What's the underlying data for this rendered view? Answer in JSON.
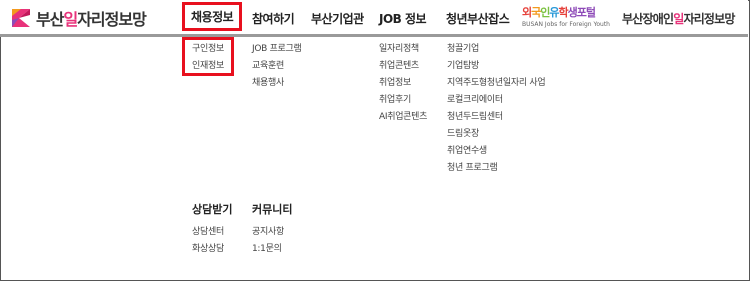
{
  "logo": {
    "prefix": "부산",
    "highlight": "일",
    "suffix": "자리정보망",
    "brand_colors": [
      "#e8327a",
      "#8e4bb8",
      "#f39a1e"
    ]
  },
  "nav": {
    "items": [
      "채용정보",
      "참여하기",
      "부산기업관",
      "JOB 정보",
      "청년부산잡스"
    ],
    "foreign_title_parts": [
      "외",
      "국",
      "인",
      "유",
      "학",
      "생",
      "포털"
    ],
    "foreign_subtitle": "BUSAN Jobs for Foreign Youth",
    "disabled_logo": {
      "prefix": "부산장애인",
      "highlight": "일",
      "suffix": "자리정보망"
    }
  },
  "menu": {
    "col1": [
      "구인정보",
      "인재정보"
    ],
    "col2": [
      "JOB 프로그램",
      "교육훈련",
      "채용행사"
    ],
    "col3": [
      "일자리정책",
      "취업콘텐츠",
      "취업정보",
      "취업후기",
      "AI취업콘텐츠"
    ],
    "col4": [
      "청끌기업",
      "기업탐방",
      "지역주도형청년일자리 사업",
      "로컬크리에이터",
      "청년두드림센터",
      "드림옷장",
      "취업연수생",
      "청년 프로그램"
    ]
  },
  "sections": {
    "consult": {
      "title": "상담받기",
      "items": [
        "상담센터",
        "화상상담"
      ]
    },
    "community": {
      "title": "커뮤니티",
      "items": [
        "공지사항",
        "1:1문의"
      ]
    }
  },
  "colors": {
    "highlight_border": "#e8101e",
    "accent": "#e8327a"
  }
}
